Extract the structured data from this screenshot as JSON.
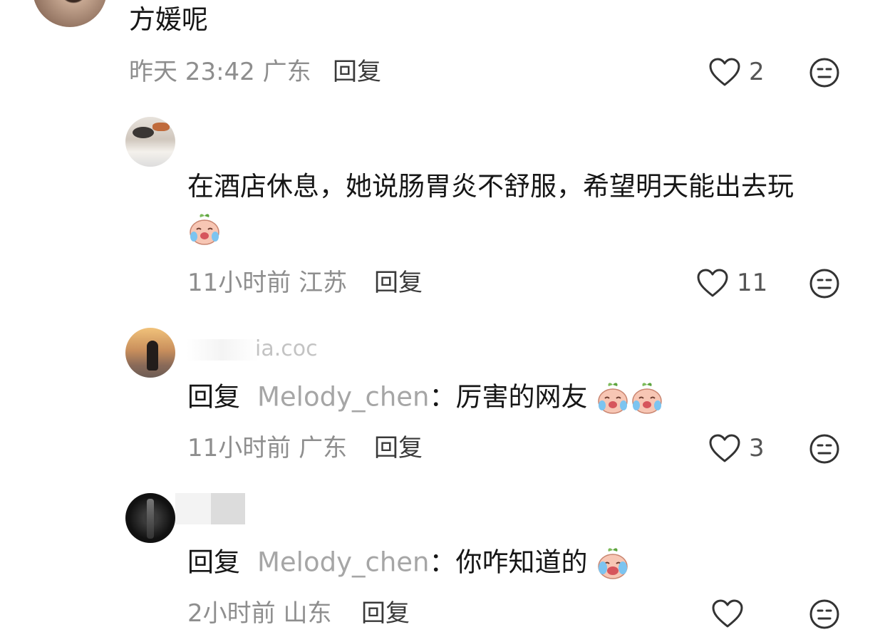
{
  "comments": [
    {
      "text": "方媛呢",
      "time_loc": "昨天 23:42 广东",
      "reply_label": "回复",
      "like_count": "2"
    },
    {
      "text": "在酒店休息，她说肠胃炎不舒服，希望明天能出去玩",
      "time_loc": "11小时前 江苏",
      "reply_label": "回复",
      "like_count": "11"
    },
    {
      "username_fragment": "ia.coc",
      "reply_prefix": "回复",
      "mention": "Melody_chen",
      "colon": "：",
      "text": "厉害的网友",
      "time_loc": "11小时前 广东",
      "reply_label": "回复",
      "like_count": "3"
    },
    {
      "reply_prefix": "回复",
      "mention": "Melody_chen",
      "colon": "：",
      "text": "你咋知道的",
      "time_loc": "2小时前 山东",
      "reply_label": "回复",
      "like_count": ""
    }
  ],
  "icons": {
    "like": "heart-outline-icon",
    "dislike": "neutral-face-icon",
    "emoji": "crying-peach-emoji"
  },
  "colors": {
    "meta_text": "#8e8e8e",
    "mention": "#a6a6a6",
    "icon_stroke": "#333333"
  }
}
